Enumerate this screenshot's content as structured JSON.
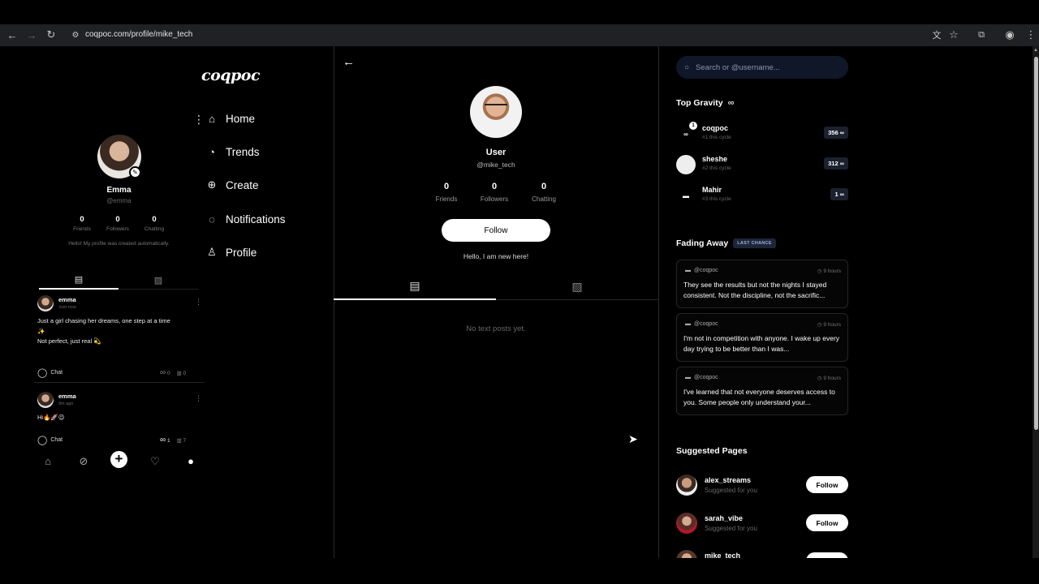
{
  "browser": {
    "url": "coqpoc.com/profile/mike_tech"
  },
  "sidebar": {
    "logo": "coqpoc",
    "items": [
      {
        "label": "Home",
        "icon": "home-icon"
      },
      {
        "label": "Trends",
        "icon": "trends-icon"
      },
      {
        "label": "Create",
        "icon": "create-icon"
      },
      {
        "label": "Notifications",
        "icon": "notifications-icon"
      },
      {
        "label": "Profile",
        "icon": "profile-icon"
      }
    ]
  },
  "mini_profile": {
    "name": "Emma",
    "handle": "@emma",
    "stats": [
      {
        "value": "0",
        "label": "Friends"
      },
      {
        "value": "0",
        "label": "Followers"
      },
      {
        "value": "0",
        "label": "Chatting"
      }
    ],
    "bio": "Hello! My profile was created automatically.",
    "posts": [
      {
        "author": "emma",
        "time": "Just now",
        "text_line1": "Just a girl chasing her dreams, one step at a time",
        "text_line2": "✨",
        "text_line3": "Not perfect, just real 💫",
        "chat_label": "Chat",
        "gravity": "0",
        "views": "0"
      },
      {
        "author": "emma",
        "time": "9m ago",
        "text_line1": "Hi🔥🚀😉",
        "chat_label": "Chat",
        "gravity": "1",
        "views": "7"
      }
    ]
  },
  "profile": {
    "name": "User",
    "handle": "@mike_tech",
    "stats": [
      {
        "value": "0",
        "label": "Friends"
      },
      {
        "value": "0",
        "label": "Followers"
      },
      {
        "value": "0",
        "label": "Chatting"
      }
    ],
    "follow_label": "Follow",
    "bio": "Hello, I am new here!",
    "empty_message": "No text posts yet."
  },
  "right": {
    "search_placeholder": "Search or @username...",
    "top_gravity": {
      "title": "Top Gravity",
      "items": [
        {
          "name": "coqpoc",
          "sub": "#1 this cycle",
          "score": "356"
        },
        {
          "name": "sheshe",
          "sub": "#2 this cycle",
          "score": "312"
        },
        {
          "name": "Mahir",
          "sub": "#3 this cycle",
          "score": "1"
        }
      ]
    },
    "fading_away": {
      "title": "Fading Away",
      "badge": "LAST CHANCE",
      "items": [
        {
          "source": "@coqpoc",
          "time": "9 hours",
          "text": "They see the results but not the nights I stayed consistent. Not the discipline, not the sacrific..."
        },
        {
          "source": "@coqpoc",
          "time": "9 hours",
          "text": "I'm not in competition with anyone. I wake up every day trying to be better than I was..."
        },
        {
          "source": "@coqpoc",
          "time": "9 hours",
          "text": "I've learned that not everyone deserves access to you. Some people only understand your..."
        }
      ]
    },
    "suggested": {
      "title": "Suggested Pages",
      "items": [
        {
          "name": "alex_streams",
          "sub": "Suggested for you",
          "button": "Follow"
        },
        {
          "name": "sarah_vibe",
          "sub": "Suggested for you",
          "button": "Follow"
        },
        {
          "name": "mike_tech"
        }
      ]
    }
  }
}
